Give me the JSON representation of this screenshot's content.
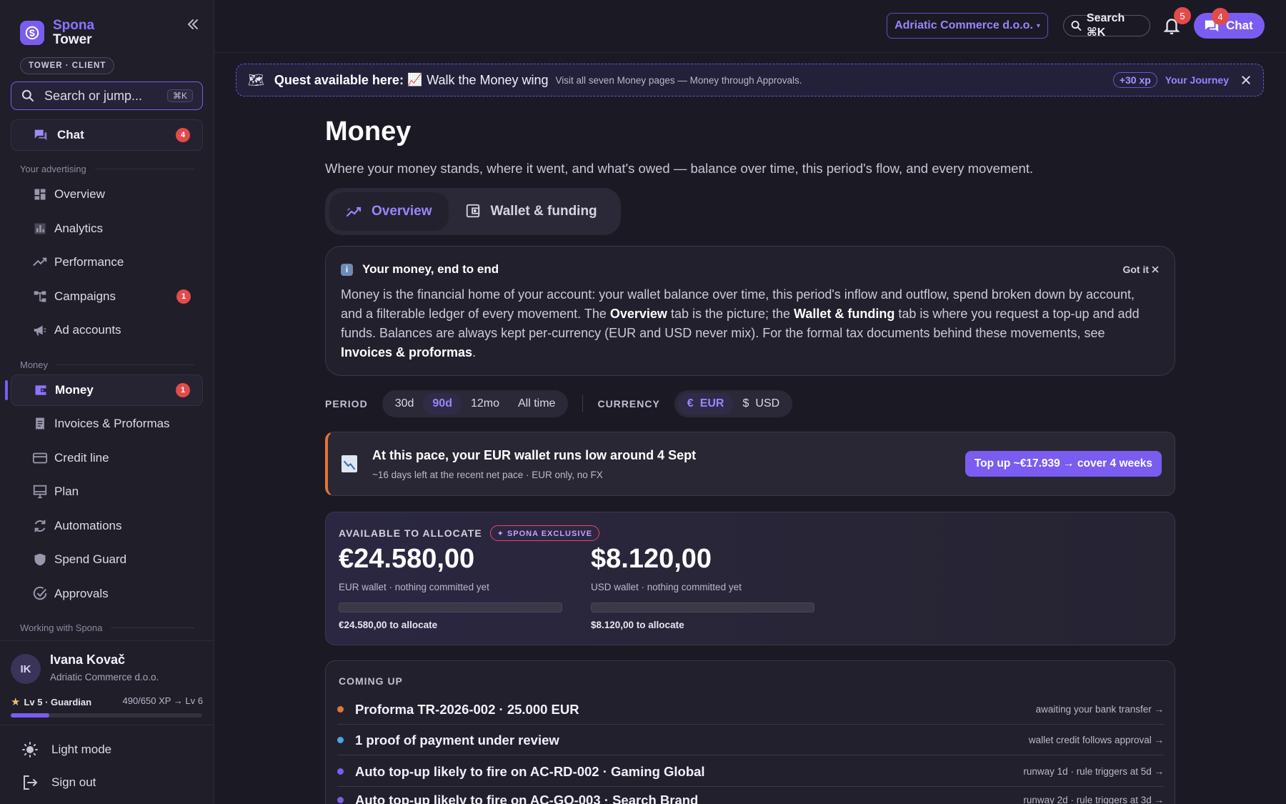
{
  "sidebar": {
    "brand_name": "Spona",
    "brand_sub": "Tower",
    "badge": "TOWER · CLIENT",
    "search_placeholder": "Search or jump...",
    "search_kbd": "⌘K",
    "chat": {
      "label": "Chat",
      "count": "4"
    },
    "section_advertising": "Your advertising",
    "advertising_items": [
      {
        "label": "Overview",
        "icon": "grid-icon"
      },
      {
        "label": "Analytics",
        "icon": "bar-chart-icon"
      },
      {
        "label": "Performance",
        "icon": "trend-up-icon"
      },
      {
        "label": "Campaigns",
        "icon": "hierarchy-icon",
        "count": "1"
      },
      {
        "label": "Ad accounts",
        "icon": "megaphone-icon"
      }
    ],
    "section_money": "Money",
    "money_items": [
      {
        "label": "Money",
        "icon": "wallet-icon",
        "count": "1",
        "active": true
      },
      {
        "label": "Invoices & Proformas",
        "icon": "receipt-icon"
      },
      {
        "label": "Credit line",
        "icon": "credit-card-icon"
      },
      {
        "label": "Plan",
        "icon": "monitor-icon"
      },
      {
        "label": "Automations",
        "icon": "refresh-icon"
      },
      {
        "label": "Spend Guard",
        "icon": "shield-icon"
      },
      {
        "label": "Approvals",
        "icon": "check-circle-icon"
      }
    ],
    "section_working": "Working with Spona",
    "user": {
      "initials": "IK",
      "name": "Ivana Kovač",
      "org": "Adriatic Commerce d.o.o.",
      "level": "Lv 5 · Guardian",
      "xp": "490/650 XP → Lv 6",
      "xp_progress": 0.2
    },
    "light_mode": "Light mode",
    "sign_out": "Sign out"
  },
  "topbar": {
    "org": "Adriatic Commerce d.o.o.",
    "org_caret": "▾",
    "search": "Search ⌘K",
    "notifications": "5",
    "chat_label": "Chat",
    "chat_count": "4"
  },
  "quest": {
    "icon": "🗺",
    "title": "Quest available here:",
    "emoji": "📈",
    "name": "Walk the Money wing",
    "desc": "Visit all seven Money pages — Money through Approvals.",
    "xp": "+30 xp",
    "journey": "Your Journey"
  },
  "page": {
    "title": "Money",
    "subtitle": "Where your money stands, where it went, and what's owed — balance over time, this period's flow, and every movement.",
    "tabs": [
      {
        "label": "Overview",
        "active": true
      },
      {
        "label": "Wallet & funding",
        "active": false
      }
    ]
  },
  "info": {
    "title": "Your money, end to end",
    "got_it": "Got it",
    "p1": "Money is the financial home of your account: your wallet balance over time, this period's inflow and outflow, spend broken down by account, and a filterable ledger of every movement. The ",
    "b1": "Overview",
    "p2": " tab is the picture; the ",
    "b2": "Wallet & funding",
    "p3": " tab is where you request a top-up and add funds. Balances are always kept per-currency (EUR and USD never mix). For the formal tax documents behind these movements, see ",
    "b3": "Invoices & proformas",
    "p4": "."
  },
  "filters": {
    "period_label": "PERIOD",
    "periods": [
      "30d",
      "90d",
      "12mo",
      "All time"
    ],
    "active_period": "90d",
    "currency_label": "CURRENCY",
    "currencies": [
      {
        "symbol": "€",
        "code": "EUR",
        "active": true
      },
      {
        "symbol": "$",
        "code": "USD",
        "active": false
      }
    ]
  },
  "alert": {
    "title": "At this pace, your EUR wallet runs low around 4 Sept",
    "sub": "~16 days left at the recent net pace · EUR only, no FX",
    "button": "Top up ~€17.939 → cover 4 weeks"
  },
  "allocate": {
    "label": "AVAILABLE TO ALLOCATE",
    "exclusive": "✦ SPONA EXCLUSIVE",
    "wallets": [
      {
        "amount": "€24.580,00",
        "sub": "EUR wallet · nothing committed yet",
        "committed": 0,
        "to_allocate": "€24.580,00 to allocate"
      },
      {
        "amount": "$8.120,00",
        "sub": "USD wallet · nothing committed yet",
        "committed": 0,
        "to_allocate": "$8.120,00 to allocate"
      }
    ]
  },
  "coming_up": {
    "label": "COMING UP",
    "rows": [
      {
        "text": "Proforma TR-2026-002 · 25.000 EUR",
        "meta": "awaiting your bank transfer →",
        "color": "#e2743c"
      },
      {
        "text": "1 proof of payment under review",
        "meta": "wallet credit follows approval →",
        "color": "#4aa3e8"
      },
      {
        "text": "Auto top-up likely to fire on AC-RD-002 · Gaming Global",
        "meta": "runway 1d · rule triggers at 5d →",
        "color": "#7b5cf0"
      },
      {
        "text": "Auto top-up likely to fire on AC-GO-003 · Search Brand",
        "meta": "runway 2d · rule triggers at 3d →",
        "color": "#7b5cf0"
      }
    ]
  }
}
